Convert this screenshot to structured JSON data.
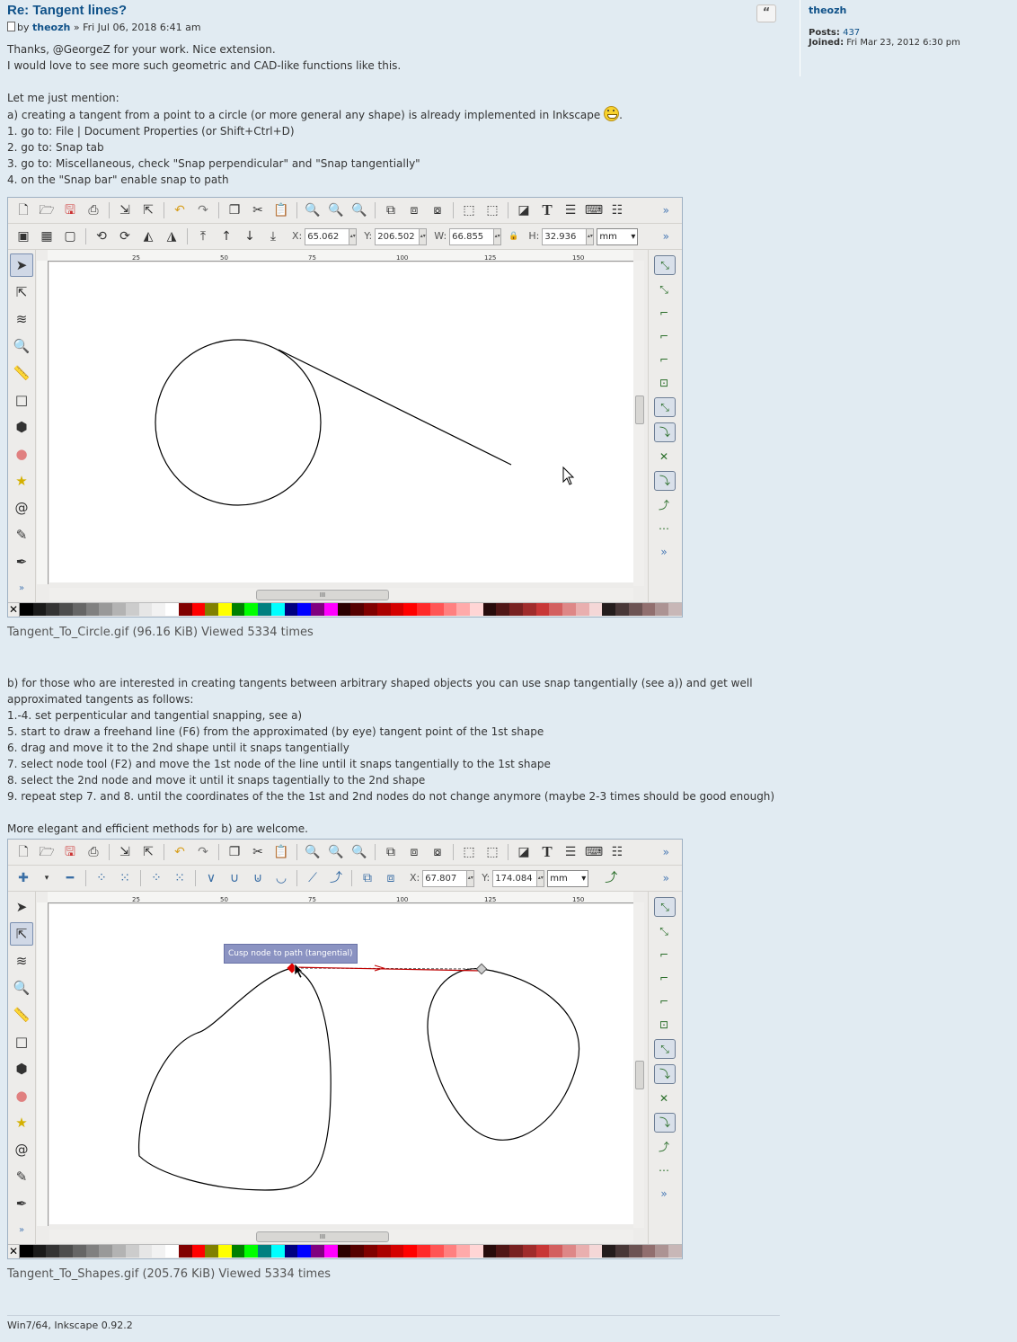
{
  "post": {
    "title": "Re: Tangent lines?",
    "by": "by",
    "author": "theozh",
    "date": "» Fri Jul 06, 2018 6:41 am",
    "lines_a": [
      "Thanks, @GeorgeZ for your work. Nice extension.",
      "I would love to see more such geometric and CAD-like functions like this."
    ],
    "mention": "Let me just mention:",
    "point_a": "a) creating a tangent from a point to a circle (or more general any shape) is already implemented in Inkscape",
    "point_a_end": ".",
    "steps_a": [
      "1. go to: File | Document Properties (or Shift+Ctrl+D)",
      "2. go to: Snap tab",
      "3. go to: Miscellaneous, check \"Snap perpendicular\" and \"Snap tangentially\"",
      "4. on the \"Snap bar\" enable snap to path"
    ],
    "point_b": [
      "b) for those who are interested in creating tangents between arbitrary shaped objects you can use snap tangentially (see a)) and get well",
      "approximated tangents as follows:",
      "1.-4. set perpenticular and tangential snapping, see a)",
      "5. start to draw a freehand line (F6) from the approximated (by eye) tangent point of the 1st shape",
      "6. drag and move it to the 2nd shape until it snaps tangentially",
      "7. select node tool (F2) and move the 1st node of the line until it snaps tangentially to the 1st shape",
      "8. select the 2nd node and move it until it snaps tagentially to the 2nd shape",
      "9. repeat step 7. and 8. until the coordinates of the the 1st and 2nd nodes do not change anymore (maybe 2-3 times should be good enough)"
    ],
    "closing": "More elegant and efficient methods for b) are welcome.",
    "signature": "Win7/64, Inkscape 0.92.2"
  },
  "attachments": [
    {
      "caption": "Tangent_To_Circle.gif (96.16 KiB) Viewed 5334 times",
      "toolbar": {
        "x_label": "X:",
        "x": "65.062",
        "y_label": "Y:",
        "y": "206.502",
        "w_label": "W:",
        "w": "66.855",
        "h_label": "H:",
        "h": "32.936",
        "unit": "mm"
      }
    },
    {
      "caption": "Tangent_To_Shapes.gif (205.76 KiB) Viewed 5334 times",
      "toolbar": {
        "x_label": "X:",
        "x": "67.807",
        "y_label": "Y:",
        "y": "174.084",
        "unit": "mm"
      },
      "tooltip": "Cusp node to path (tangential)"
    }
  ],
  "ruler": {
    "ticks": [
      "25",
      "50",
      "75",
      "100",
      "125",
      "150"
    ]
  },
  "glyphs": {
    "more": "»",
    "lock": "🔒",
    "scroll_grip": "III",
    "x_swatch": "✕",
    "dropdown": "▾",
    "spin": "▴▾"
  },
  "profile": {
    "name": "theozh",
    "posts_label": "Posts:",
    "posts": "437",
    "joined_label": "Joined:",
    "joined": "Fri Mar 23, 2012 6:30 pm"
  },
  "quote_glyph": "“",
  "palette": [
    "#000000",
    "#1a1a1a",
    "#333333",
    "#4d4d4d",
    "#666666",
    "#808080",
    "#999999",
    "#b3b3b3",
    "#cccccc",
    "#e6e6e6",
    "#f2f2f2",
    "#ffffff",
    "#800000",
    "#ff0000",
    "#808000",
    "#ffff00",
    "#008000",
    "#00ff00",
    "#008080",
    "#00ffff",
    "#000080",
    "#0000ff",
    "#800080",
    "#ff00ff",
    "#2b0000",
    "#550000",
    "#800000",
    "#aa0000",
    "#d40000",
    "#ff0000",
    "#ff2a2a",
    "#ff5555",
    "#ff8080",
    "#ffaaaa",
    "#ffd5d5",
    "#280b0b",
    "#501616",
    "#782121",
    "#a02c2c",
    "#c83737",
    "#d35f5f",
    "#de8787",
    "#e9afaf",
    "#f4d7d7",
    "#241c1c",
    "#483737",
    "#6c5353",
    "#916f6f",
    "#ac9393",
    "#c8b7b7"
  ]
}
